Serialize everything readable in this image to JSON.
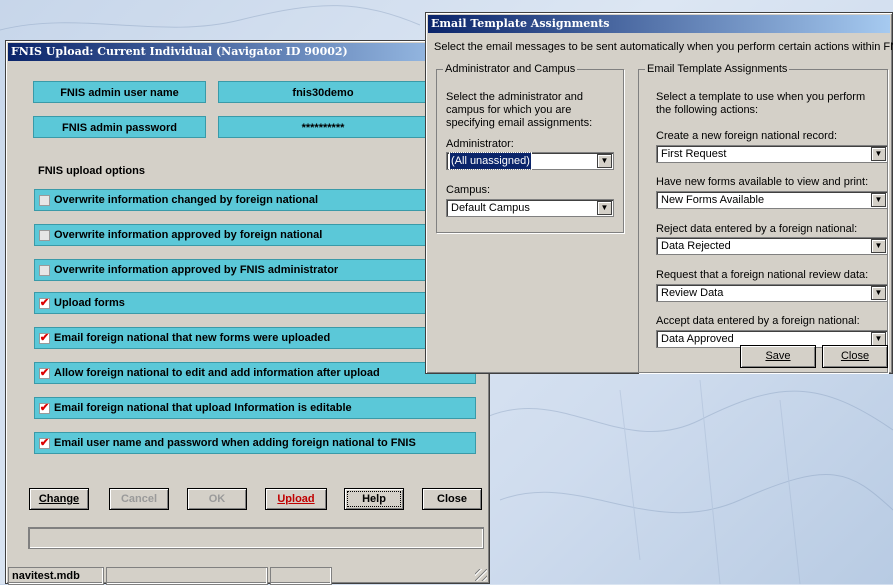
{
  "upload_window": {
    "title": "FNIS Upload: Current Individual (Navigator ID 90002)",
    "admin_user_label": "FNIS admin user name",
    "admin_user_value": "fnis30demo",
    "admin_password_label": "FNIS admin password",
    "admin_password_value": "**********",
    "options_title": "FNIS upload options",
    "options": [
      {
        "label": "Overwrite information changed by foreign national",
        "checked": false
      },
      {
        "label": "Overwrite information approved by foreign national",
        "checked": false
      },
      {
        "label": "Overwrite information approved by FNIS administrator",
        "checked": false
      },
      {
        "label": "Upload forms",
        "checked": true
      },
      {
        "label": "Email foreign national that new forms were uploaded",
        "checked": true
      },
      {
        "label": "Allow foreign national to edit and add information after upload",
        "checked": true
      },
      {
        "label": "Email foreign national that upload Information is editable",
        "checked": true
      },
      {
        "label": "Email user name and password when adding foreign national to FNIS",
        "checked": true
      }
    ],
    "buttons": {
      "change": "Change",
      "cancel": "Cancel",
      "ok": "OK",
      "upload": "Upload",
      "help": "Help",
      "close": "Close"
    },
    "status": {
      "db_file": "navitest.mdb"
    }
  },
  "email_window": {
    "title": "Email Template Assignments",
    "description": "Select the email messages to be sent automatically when you perform certain actions within FNIS:",
    "admin_group": {
      "legend": "Administrator and Campus",
      "text": "Select the administrator and campus for which you are specifying email assignments:",
      "administrator_label": "Administrator:",
      "administrator_value": "(All unassigned)",
      "campus_label": "Campus:",
      "campus_value": "Default Campus"
    },
    "template_group": {
      "legend": "Email Template Assignments",
      "text": "Select a template to use when you perform the following actions:",
      "actions": [
        {
          "label": "Create a new foreign national record:",
          "template": "First Request"
        },
        {
          "label": "Have new forms available to view and print:",
          "template": "New Forms Available"
        },
        {
          "label": "Reject data entered by a foreign national:",
          "template": "Data Rejected"
        },
        {
          "label": "Request that a foreign national review data:",
          "template": "Review Data"
        },
        {
          "label": "Accept data entered by a foreign national:",
          "template": "Data Approved"
        }
      ]
    },
    "buttons": {
      "save": "Save",
      "close": "Close"
    }
  }
}
